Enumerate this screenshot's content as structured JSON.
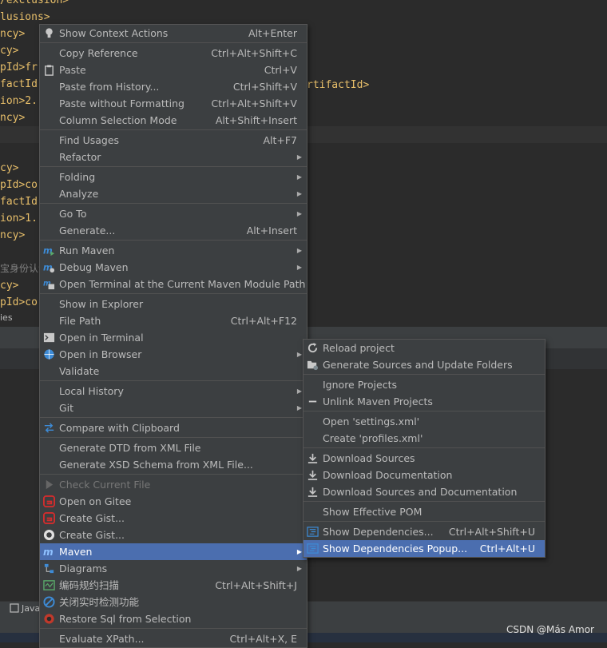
{
  "editor": {
    "lines": [
      {
        "text": "/exclusion>",
        "kind": "t"
      },
      {
        "text": "lusions>",
        "kind": "t"
      },
      {
        "text": "ncy>",
        "kind": "t"
      },
      {
        "text": "cy>",
        "kind": "t"
      },
      {
        "text": "pId>fr",
        "kind": "t"
      },
      {
        "text": "factId",
        "kind": "t"
      },
      {
        "text": "ion>2.",
        "kind": "t"
      },
      {
        "text": "ncy>",
        "kind": "t"
      },
      {
        "text": "",
        "kind": "hl"
      },
      {
        "text": "",
        "kind": "t"
      },
      {
        "text": "cy>",
        "kind": "t"
      },
      {
        "text": "pId>co",
        "kind": "t"
      },
      {
        "text": "factId",
        "kind": "t"
      },
      {
        "text": "ion>1.",
        "kind": "t"
      },
      {
        "text": "ncy>",
        "kind": "t"
      },
      {
        "text": "",
        "kind": "t"
      },
      {
        "text": "宝身份认证",
        "kind": "g"
      },
      {
        "text": "cy>",
        "kind": "t"
      },
      {
        "text": "pId>co",
        "kind": "t"
      }
    ],
    "right_fragment": "rtifactId>",
    "breadcrumb_fragment": "ies"
  },
  "status": {
    "java_tab": "Java",
    "watermark": "CSDN @Más Amor"
  },
  "context_menu": {
    "groups": [
      [
        {
          "name": "show-context-actions",
          "label": "Show Context Actions",
          "shortcut": "Alt+Enter",
          "icon": "bulb-icon"
        }
      ],
      [
        {
          "name": "copy-reference",
          "label": "Copy Reference",
          "shortcut": "Ctrl+Alt+Shift+C"
        },
        {
          "name": "paste",
          "label": "Paste",
          "shortcut": "Ctrl+V",
          "icon": "clipboard-icon"
        },
        {
          "name": "paste-from-history",
          "label": "Paste from History...",
          "shortcut": "Ctrl+Shift+V"
        },
        {
          "name": "paste-without-formatting",
          "label": "Paste without Formatting",
          "shortcut": "Ctrl+Alt+Shift+V"
        },
        {
          "name": "column-selection-mode",
          "label": "Column Selection Mode",
          "shortcut": "Alt+Shift+Insert"
        }
      ],
      [
        {
          "name": "find-usages",
          "label": "Find Usages",
          "shortcut": "Alt+F7"
        },
        {
          "name": "refactor",
          "label": "Refactor",
          "submenu": true
        }
      ],
      [
        {
          "name": "folding",
          "label": "Folding",
          "submenu": true
        },
        {
          "name": "analyze",
          "label": "Analyze",
          "submenu": true
        }
      ],
      [
        {
          "name": "go-to",
          "label": "Go To",
          "submenu": true
        },
        {
          "name": "generate",
          "label": "Generate...",
          "shortcut": "Alt+Insert"
        }
      ],
      [
        {
          "name": "run-maven",
          "label": "Run Maven",
          "submenu": true,
          "icon": "maven-run-icon"
        },
        {
          "name": "debug-maven",
          "label": "Debug Maven",
          "submenu": true,
          "icon": "maven-debug-icon"
        },
        {
          "name": "open-terminal-maven",
          "label": "Open Terminal at the Current Maven Module Path",
          "icon": "maven-terminal-icon"
        }
      ],
      [
        {
          "name": "show-in-explorer",
          "label": "Show in Explorer"
        },
        {
          "name": "file-path",
          "label": "File Path",
          "shortcut": "Ctrl+Alt+F12"
        },
        {
          "name": "open-in-terminal",
          "label": "Open in Terminal",
          "icon": "terminal-icon"
        },
        {
          "name": "open-in-browser",
          "label": "Open in Browser",
          "submenu": true,
          "icon": "globe-icon"
        },
        {
          "name": "validate",
          "label": "Validate"
        }
      ],
      [
        {
          "name": "local-history",
          "label": "Local History",
          "submenu": true
        },
        {
          "name": "git",
          "label": "Git",
          "submenu": true
        }
      ],
      [
        {
          "name": "compare-with-clipboard",
          "label": "Compare with Clipboard",
          "icon": "compare-icon"
        }
      ],
      [
        {
          "name": "generate-dtd",
          "label": "Generate DTD from XML File"
        },
        {
          "name": "generate-xsd",
          "label": "Generate XSD Schema from XML File..."
        }
      ],
      [
        {
          "name": "check-current-file",
          "label": "Check Current File",
          "disabled": true,
          "icon": "play-icon"
        },
        {
          "name": "open-on-gitee",
          "label": "Open on Gitee",
          "icon": "gitee-icon"
        },
        {
          "name": "create-gist-gitee",
          "label": "Create Gist...",
          "icon": "gitee-icon"
        },
        {
          "name": "create-gist-github",
          "label": "Create Gist...",
          "icon": "github-icon"
        },
        {
          "name": "maven",
          "label": "Maven",
          "submenu": true,
          "selected": true,
          "icon": "maven-icon"
        },
        {
          "name": "diagrams",
          "label": "Diagrams",
          "submenu": true,
          "icon": "diagram-icon"
        },
        {
          "name": "code-guideline-scan",
          "label": "编码规约扫描",
          "shortcut": "Ctrl+Alt+Shift+J",
          "icon": "scan-icon"
        },
        {
          "name": "close-realtime-check",
          "label": "关闭实时检测功能",
          "icon": "no-entry-icon"
        },
        {
          "name": "restore-sql",
          "label": "Restore Sql from Selection",
          "icon": "sql-icon"
        }
      ],
      [
        {
          "name": "evaluate-xpath",
          "label": "Evaluate XPath...",
          "shortcut": "Ctrl+Alt+X, E"
        }
      ]
    ]
  },
  "maven_submenu": {
    "groups": [
      [
        {
          "name": "reload-project",
          "label": "Reload project",
          "icon": "reload-icon"
        },
        {
          "name": "generate-sources",
          "label": "Generate Sources and Update Folders",
          "icon": "folder-gear-icon"
        }
      ],
      [
        {
          "name": "ignore-projects",
          "label": "Ignore Projects"
        },
        {
          "name": "unlink-maven-projects",
          "label": "Unlink Maven Projects",
          "icon": "minus-icon"
        }
      ],
      [
        {
          "name": "open-settings-xml",
          "label": "Open 'settings.xml'"
        },
        {
          "name": "create-profiles-xml",
          "label": "Create 'profiles.xml'"
        }
      ],
      [
        {
          "name": "download-sources",
          "label": "Download Sources",
          "icon": "download-icon"
        },
        {
          "name": "download-documentation",
          "label": "Download Documentation",
          "icon": "download-icon"
        },
        {
          "name": "download-sources-docs",
          "label": "Download Sources and Documentation",
          "icon": "download-icon"
        }
      ],
      [
        {
          "name": "show-effective-pom",
          "label": "Show Effective POM"
        }
      ],
      [
        {
          "name": "show-dependencies",
          "label": "Show Dependencies...",
          "shortcut": "Ctrl+Alt+Shift+U",
          "icon": "dependencies-icon"
        },
        {
          "name": "show-dependencies-popup",
          "label": "Show Dependencies Popup...",
          "shortcut": "Ctrl+Alt+U",
          "selected": true,
          "icon": "dependencies-icon"
        }
      ]
    ]
  }
}
